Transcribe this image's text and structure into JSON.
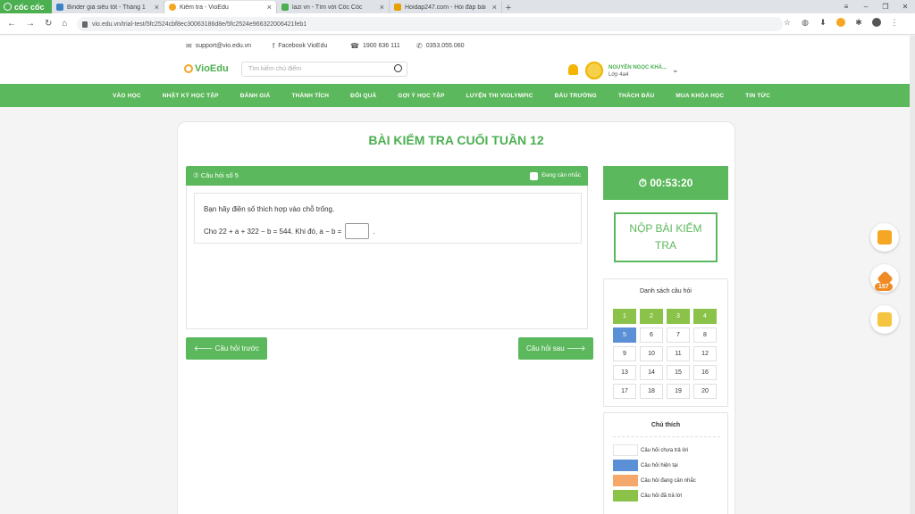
{
  "browser": {
    "brand": "cốc cốc",
    "tabs": [
      {
        "title": "Binder giá siêu tốt - Tháng 1",
        "color": "#3b82c4",
        "active": false
      },
      {
        "title": "Kiểm tra - VioEdu",
        "color": "#f5a623",
        "active": true
      },
      {
        "title": "lazi vn - Tìm với Cốc Cốc",
        "color": "#4caf50",
        "active": false
      },
      {
        "title": "Hoidap247.com - Hỏi đáp bài",
        "color": "#e8a000",
        "active": false
      }
    ],
    "url": "vio.edu.vn/trial-test/5fc2524cbf8ec30063186d8e/5fc2524e966322006421feb1"
  },
  "header": {
    "email": "support@vio.edu.vn",
    "facebook": "Facebook VioEdu",
    "phone1": "1900 636 111",
    "phone2": "0353.055.060",
    "logo": "VioEdu",
    "search_placeholder": "Tìm kiếm chủ điểm",
    "user_name": "NGUYỄN NGỌC KHÁ...",
    "user_class": "Lớp 4a4"
  },
  "menu": [
    "VÀO HỌC",
    "NHẬT KÝ HỌC TẬP",
    "ĐÁNH GIÁ",
    "THÀNH TÍCH",
    "ĐỔI QUÀ",
    "GỢI Ý HỌC TẬP",
    "LUYỆN THI VIOLYMPIC",
    "ĐẤU TRƯỜNG",
    "THÁCH ĐẤU",
    "MUA KHÓA HỌC",
    "TIN TỨC"
  ],
  "exam": {
    "title": "BÀI KIỂM TRA CUỐI TUẦN 12",
    "question_label": "⑦ Câu hỏi số 5",
    "mark_label": "Đang cân nhắc",
    "instruction": "Bạn hãy điền số thích hợp vào chỗ trống.",
    "expression": "Cho 22 + a + 322 − b = 544. Khi đó, a − b =",
    "suffix": ".",
    "prev": "🡐 Câu hỏi trước",
    "next": "Câu hỏi sau 🡒",
    "timer": "⏱ 00:53:20",
    "submit": "NỘP BÀI KIỂM TRA",
    "list_title": "Danh sách câu hỏi",
    "questions": [
      "1",
      "2",
      "3",
      "4",
      "5",
      "6",
      "7",
      "8",
      "9",
      "10",
      "11",
      "12",
      "13",
      "14",
      "15",
      "16",
      "17",
      "18",
      "19",
      "20"
    ],
    "legend_title": "Chú thích",
    "legend": [
      {
        "label": "Câu hỏi chưa trả lời",
        "color": "#ffffff"
      },
      {
        "label": "Câu hỏi hiện tại",
        "color": "#5b8fd6"
      },
      {
        "label": "Câu hỏi đang cân nhắc",
        "color": "#f5a86a"
      },
      {
        "label": "Câu hỏi đã trả lời",
        "color": "#8bc34a"
      }
    ],
    "diamonds": "157"
  }
}
